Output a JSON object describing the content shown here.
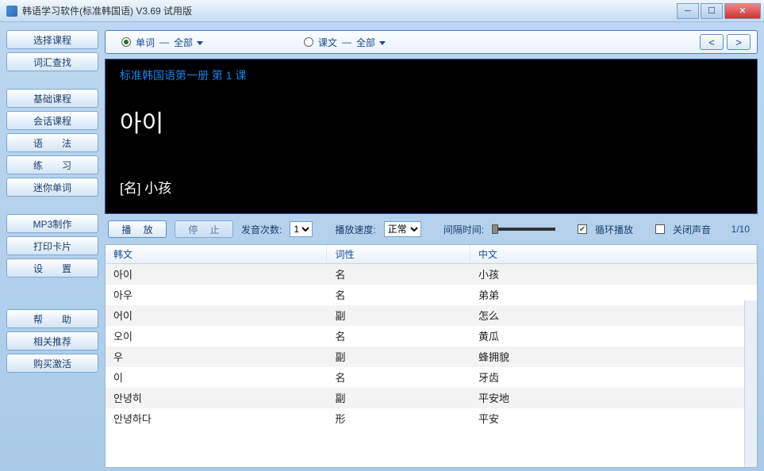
{
  "window": {
    "title": "韩语学习软件(标准韩国语) V3.69 试用版"
  },
  "sidebar": {
    "group1": [
      "选择课程",
      "词汇查找"
    ],
    "group2": [
      "基础课程",
      "会话课程",
      "语　　法",
      "练　　习",
      "迷你单词"
    ],
    "group3": [
      "MP3制作",
      "打印卡片",
      "设　　置"
    ],
    "group4": [
      "帮　　助",
      "相关推荐",
      "购买激活"
    ]
  },
  "filter": {
    "opt1_label": "单词",
    "opt1_scope": "全部",
    "opt2_label": "课文",
    "opt2_scope": "全部",
    "sep": "—"
  },
  "display": {
    "lesson": "标准韩国语第一册 第 1 课",
    "word": "아이",
    "meaning": "[名]  小孩"
  },
  "controls": {
    "play": "播  放",
    "stop": "停  止",
    "count_label": "发音次数:",
    "count_value": "1",
    "speed_label": "播放速度:",
    "speed_value": "正常",
    "interval_label": "间隔时间:",
    "loop_label": "循环播放",
    "mute_label": "关闭声音",
    "counter": "1/10"
  },
  "table": {
    "headers": [
      "韩文",
      "词性",
      "中文"
    ],
    "rows": [
      [
        "아이",
        "名",
        "小孩"
      ],
      [
        "아우",
        "名",
        "弟弟"
      ],
      [
        "어이",
        "副",
        "怎么"
      ],
      [
        "오이",
        "名",
        "黄瓜"
      ],
      [
        "우",
        "副",
        "蜂拥貌"
      ],
      [
        "이",
        "名",
        "牙齿"
      ],
      [
        "안녕히",
        "副",
        "平安地"
      ],
      [
        "안녕하다",
        "形",
        "平安"
      ]
    ]
  }
}
